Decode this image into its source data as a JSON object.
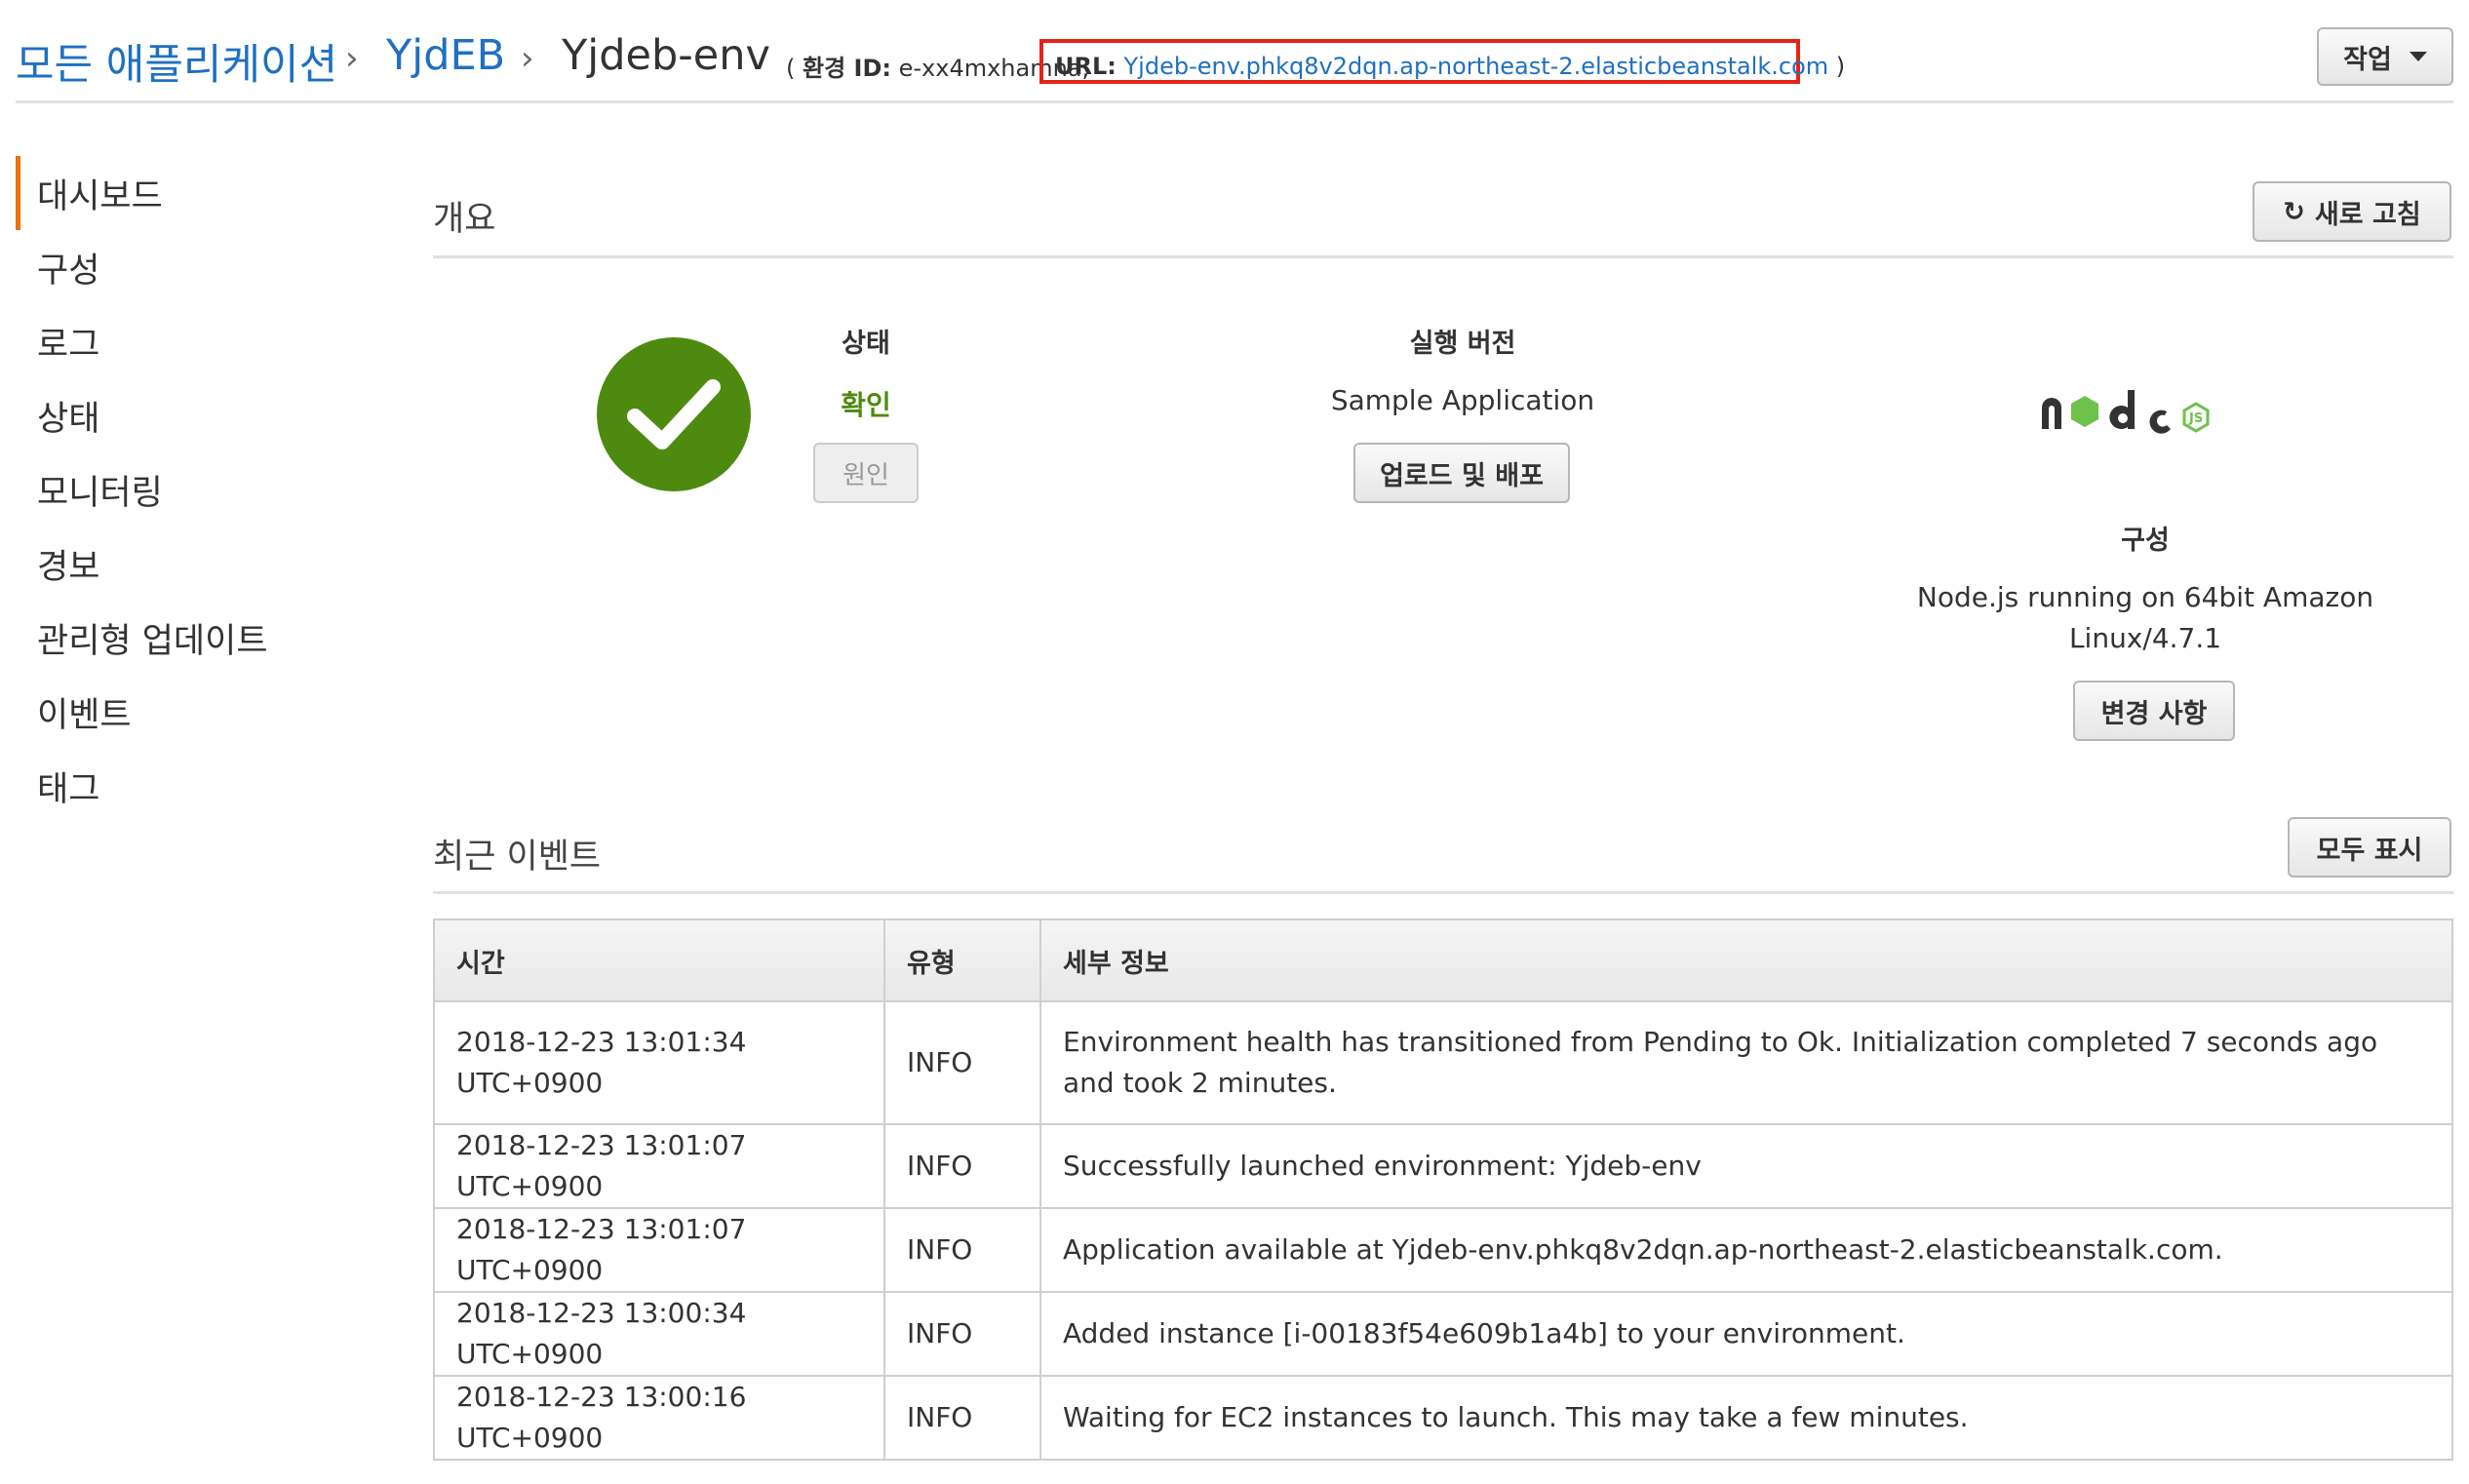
{
  "breadcrumb": {
    "all_apps": "모든 애플리케이션",
    "app": "YjdEB",
    "env": "Yjdeb-env",
    "sep": "›"
  },
  "env_meta": {
    "open_paren": "(",
    "env_id_label": "환경 ID:",
    "env_id_value": "e-xx4mxhamna,",
    "url_label": "URL:",
    "url_value": "Yjdeb-env.phkq8v2dqn.ap-northeast-2.elasticbeanstalk.com",
    "close_paren": ")"
  },
  "actions_button": "작업",
  "sidebar": {
    "items": [
      {
        "label": "대시보드",
        "active": true
      },
      {
        "label": "구성",
        "active": false
      },
      {
        "label": "로그",
        "active": false
      },
      {
        "label": "상태",
        "active": false
      },
      {
        "label": "모니터링",
        "active": false
      },
      {
        "label": "경보",
        "active": false
      },
      {
        "label": "관리형 업데이트",
        "active": false
      },
      {
        "label": "이벤트",
        "active": false
      },
      {
        "label": "태그",
        "active": false
      }
    ]
  },
  "overview": {
    "title": "개요",
    "refresh_button": "새로 고침",
    "status_label": "상태",
    "status_value": "확인",
    "cause_button": "원인",
    "running_version_label": "실행 버전",
    "running_version_value": "Sample Application",
    "upload_button": "업로드 및 배포",
    "config_label": "구성",
    "config_value_line1": "Node.js running on 64bit Amazon",
    "config_value_line2": "Linux/4.7.1",
    "change_button": "변경 사항"
  },
  "events": {
    "title": "최근 이벤트",
    "show_all_button": "모두 표시",
    "columns": [
      "시간",
      "유형",
      "세부 정보"
    ],
    "rows": [
      {
        "time": "2018-12-23 13:01:34 UTC+0900",
        "type": "INFO",
        "details": "Environment health has transitioned from Pending to Ok. Initialization completed 7 seconds ago and took 2 minutes."
      },
      {
        "time": "2018-12-23 13:01:07 UTC+0900",
        "type": "INFO",
        "details": "Successfully launched environment: Yjdeb-env"
      },
      {
        "time": "2018-12-23 13:01:07 UTC+0900",
        "type": "INFO",
        "details": "Application available at Yjdeb-env.phkq8v2dqn.ap-northeast-2.elasticbeanstalk.com."
      },
      {
        "time": "2018-12-23 13:00:34 UTC+0900",
        "type": "INFO",
        "details": "Added instance [i-00183f54e609b1a4b] to your environment."
      },
      {
        "time": "2018-12-23 13:00:16 UTC+0900",
        "type": "INFO",
        "details": "Waiting for EC2 instances to launch. This may take a few minutes."
      }
    ]
  },
  "icons": {
    "status": "check-circle-icon",
    "refresh": "refresh-icon",
    "platform": "nodejs-logo"
  },
  "colors": {
    "link": "#1f70c1",
    "ok": "#4f8a10",
    "highlight_box": "#e3241b",
    "active_nav": "#ec7211"
  }
}
